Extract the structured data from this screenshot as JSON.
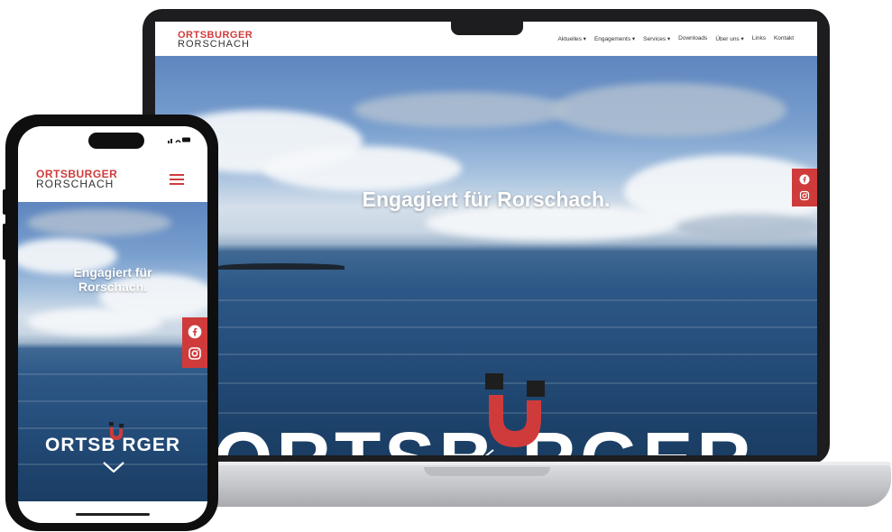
{
  "brand": {
    "logo_line1": "ORTSBURGER",
    "logo_line2": "RORSCHACH",
    "accent_color": "#cf3b3b",
    "text_color": "#333333"
  },
  "desktop": {
    "nav": [
      {
        "label": "Aktuelles ▾"
      },
      {
        "label": "Engagements ▾"
      },
      {
        "label": "Services ▾"
      },
      {
        "label": "Downloads"
      },
      {
        "label": "Über uns ▾"
      },
      {
        "label": "Links"
      },
      {
        "label": "Kontakt"
      }
    ],
    "headline": "Engagiert für Rorschach.",
    "bigword": "ORTSB   RGER"
  },
  "mobile": {
    "headline_line1": "Engagiert für",
    "headline_line2": "Rorschach.",
    "bigword": "ORTSB  RGER"
  },
  "social": [
    {
      "icon": "facebook-icon"
    },
    {
      "icon": "instagram-icon"
    }
  ]
}
